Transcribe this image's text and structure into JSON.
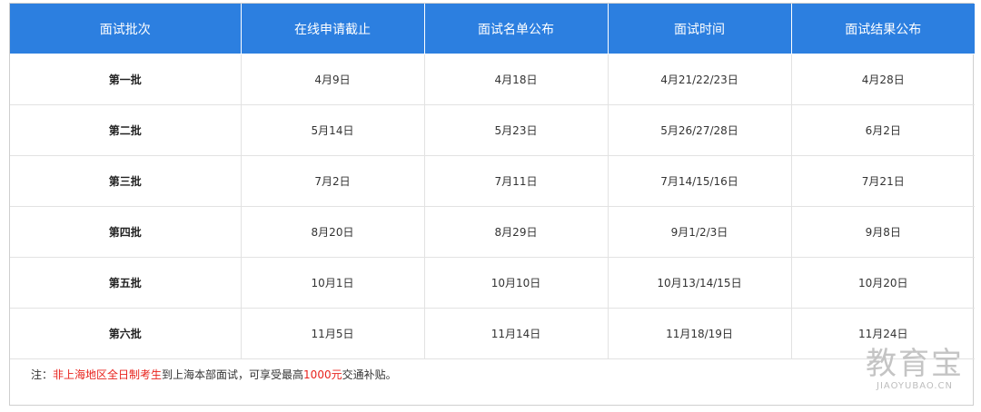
{
  "table": {
    "headers": [
      "面试批次",
      "在线申请截止",
      "面试名单公布",
      "面试时间",
      "面试结果公布"
    ],
    "rows": [
      [
        "第一批",
        "4月9日",
        "4月18日",
        "4月21/22/23日",
        "4月28日"
      ],
      [
        "第二批",
        "5月14日",
        "5月23日",
        "5月26/27/28日",
        "6月2日"
      ],
      [
        "第三批",
        "7月2日",
        "7月11日",
        "7月14/15/16日",
        "7月21日"
      ],
      [
        "第四批",
        "8月20日",
        "8月29日",
        "9月1/2/3日",
        "9月8日"
      ],
      [
        "第五批",
        "10月1日",
        "10月10日",
        "10月13/14/15日",
        "10月20日"
      ],
      [
        "第六批",
        "11月5日",
        "11月14日",
        "11月18/19日",
        "11月24日"
      ]
    ]
  },
  "note": {
    "prefix": "注：",
    "highlight1": "非上海地区全日制考生",
    "middle": "到上海本部面试，可享受最高",
    "highlight2": "1000元",
    "suffix": "交通补贴。"
  },
  "watermark": {
    "main": "教育宝",
    "sub": "JIAOYUBAO.CN"
  },
  "colors": {
    "header_bg": "#2c7fe0",
    "highlight": "#e8231d"
  }
}
